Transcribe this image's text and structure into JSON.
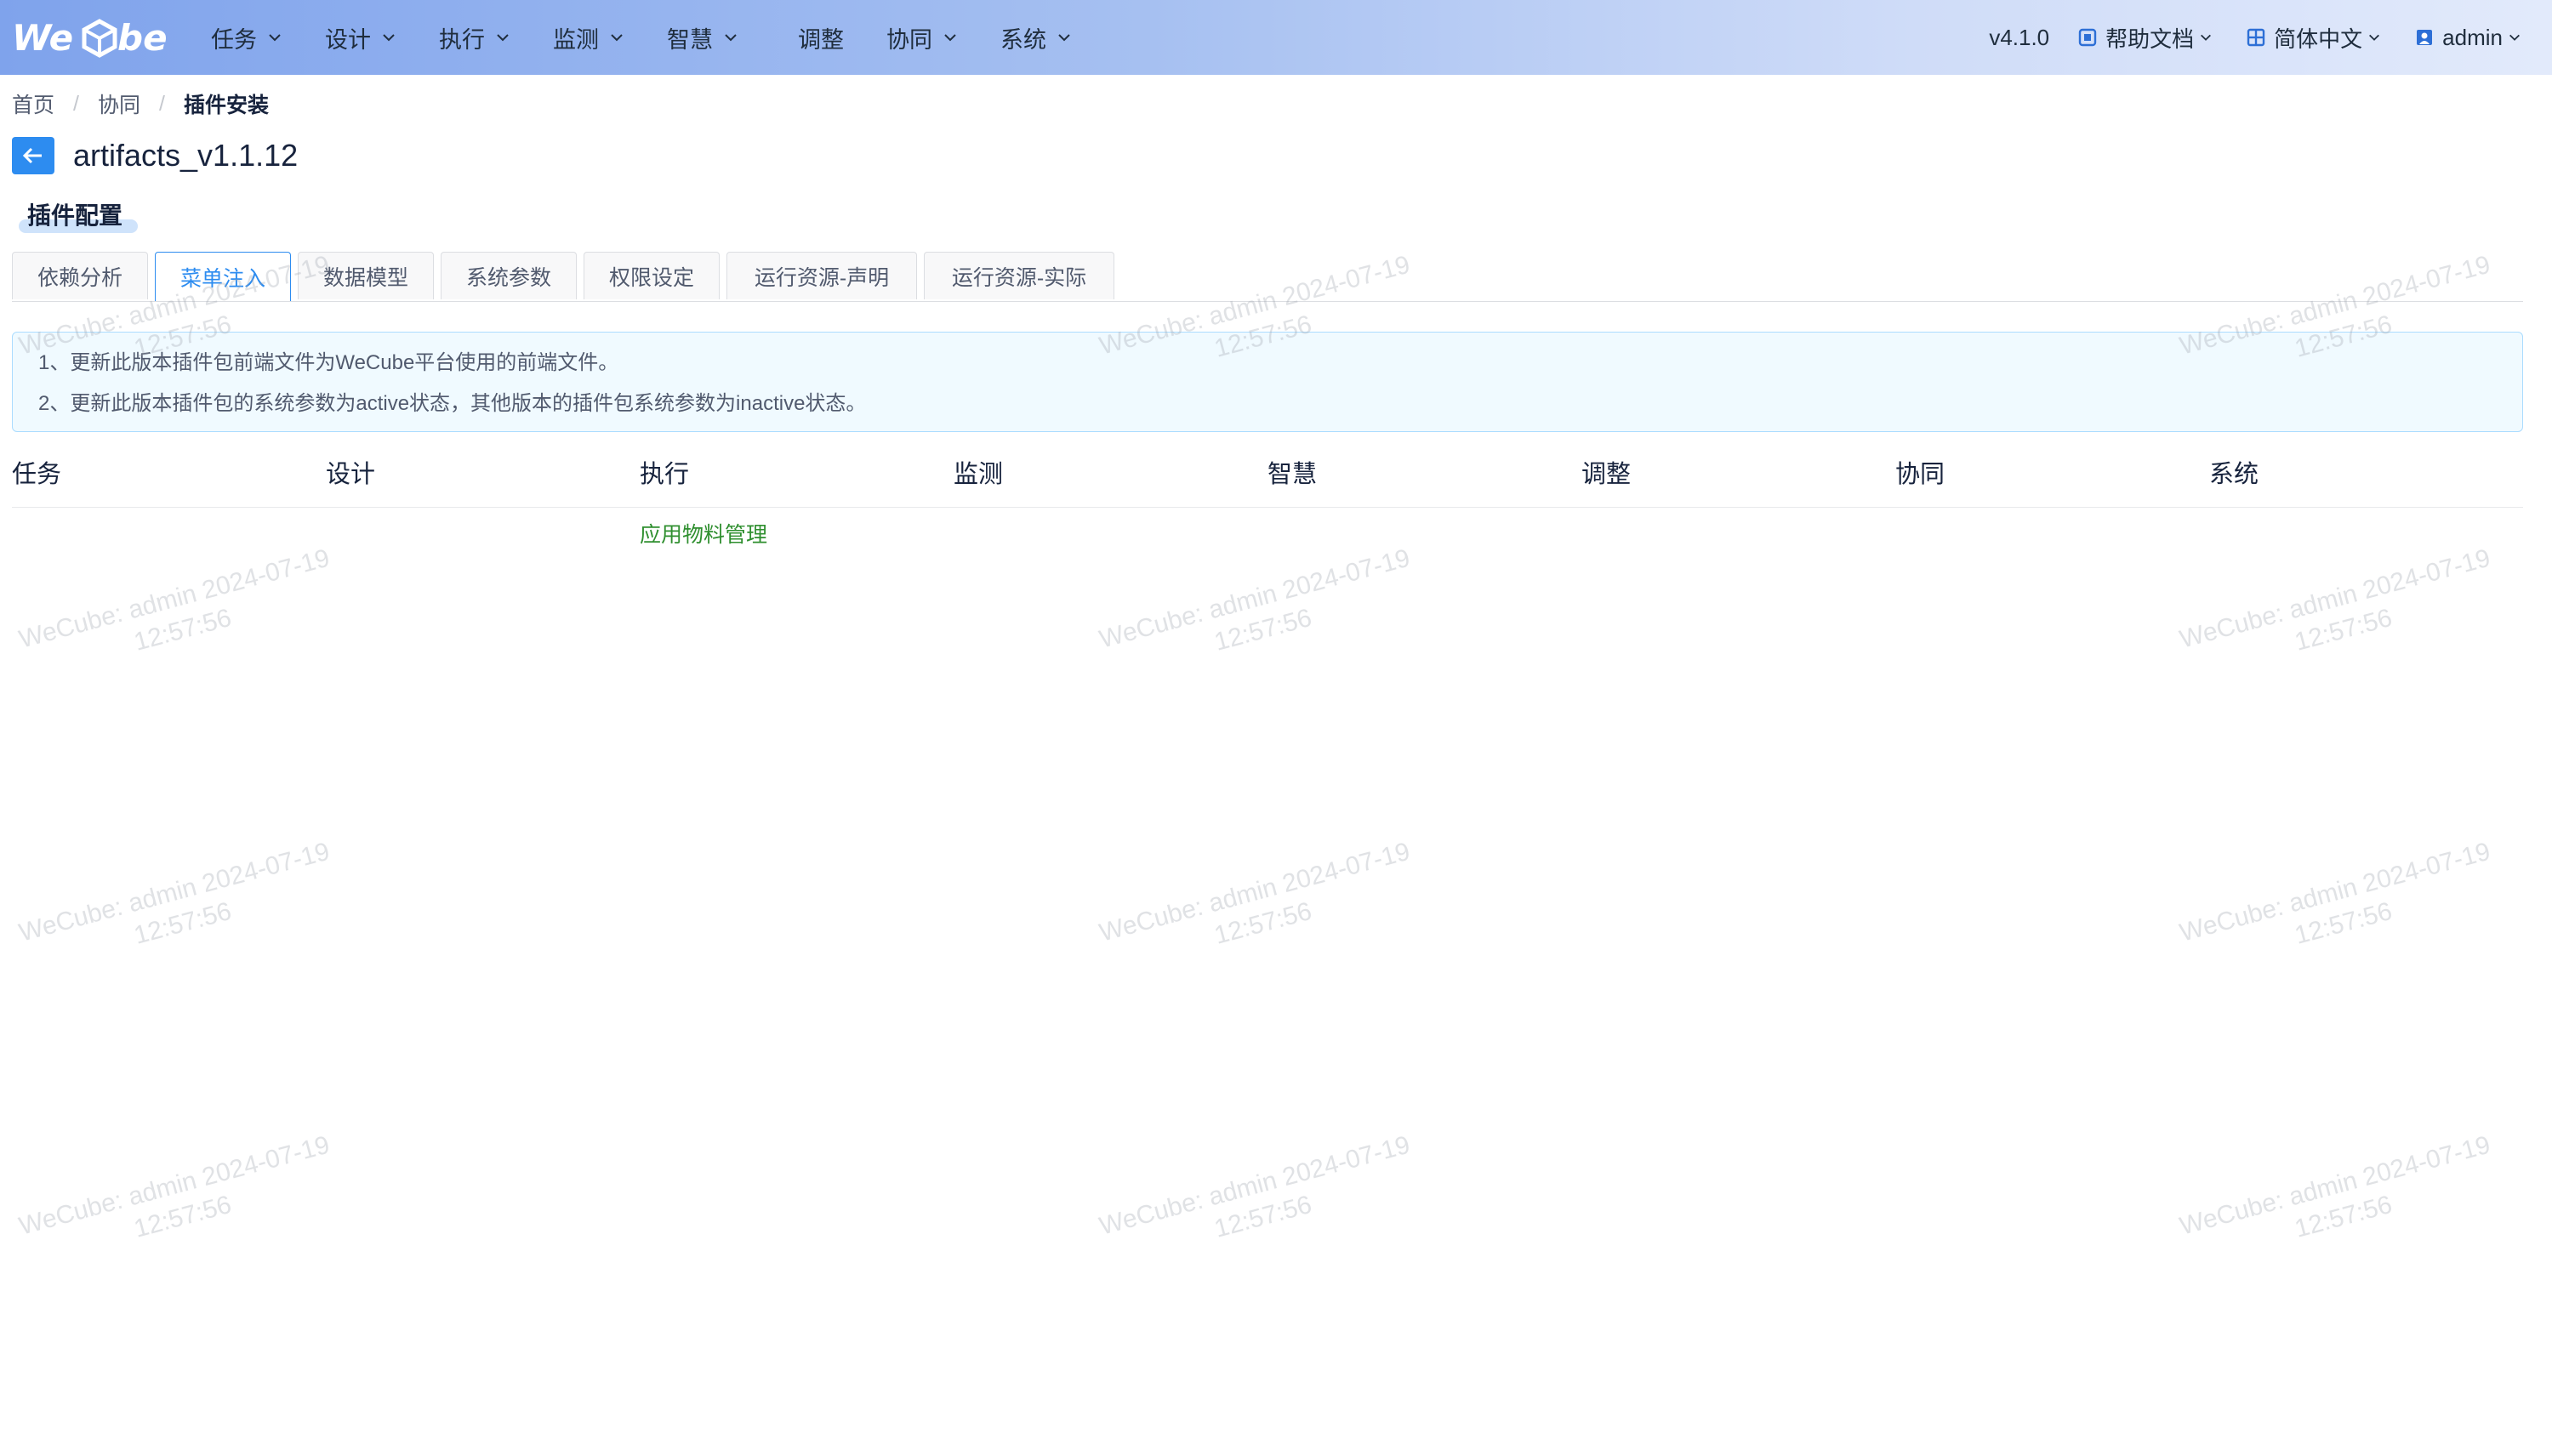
{
  "app": {
    "logo_text": "WeCube",
    "version": "v4.1.0",
    "accent_color": "#2d8cf0"
  },
  "nav": {
    "items": [
      {
        "label": "任务",
        "dropdown": true
      },
      {
        "label": "设计",
        "dropdown": true
      },
      {
        "label": "执行",
        "dropdown": true
      },
      {
        "label": "监测",
        "dropdown": true
      },
      {
        "label": "智慧",
        "dropdown": true
      },
      {
        "label": "调整",
        "dropdown": false
      },
      {
        "label": "协同",
        "dropdown": true
      },
      {
        "label": "系统",
        "dropdown": true
      }
    ]
  },
  "header_right": {
    "help_label": "帮助文档",
    "language_label": "简体中文",
    "user_label": "admin"
  },
  "breadcrumb": {
    "home": "首页",
    "parent": "协同",
    "current": "插件安装",
    "separator": "/"
  },
  "page": {
    "title": "artifacts_v1.1.12",
    "section_title": "插件配置"
  },
  "tabs": [
    {
      "label": "依赖分析",
      "active": false
    },
    {
      "label": "菜单注入",
      "active": true
    },
    {
      "label": "数据模型",
      "active": false
    },
    {
      "label": "系统参数",
      "active": false
    },
    {
      "label": "权限设定",
      "active": false
    },
    {
      "label": "运行资源-声明",
      "active": false
    },
    {
      "label": "运行资源-实际",
      "active": false
    }
  ],
  "notice": {
    "line1": "1、更新此版本插件包前端文件为WeCube平台使用的前端文件。",
    "line2": "2、更新此版本插件包的系统参数为active状态，其他版本的插件包系统参数为inactive状态。"
  },
  "menu_table": {
    "columns": [
      "任务",
      "设计",
      "执行",
      "监测",
      "智慧",
      "调整",
      "协同",
      "系统"
    ],
    "items": [
      {
        "column": "执行",
        "label": "应用物料管理"
      }
    ]
  },
  "watermark": {
    "line1": "WeCube: admin 2024-07-19",
    "line2": "12:57:56"
  }
}
